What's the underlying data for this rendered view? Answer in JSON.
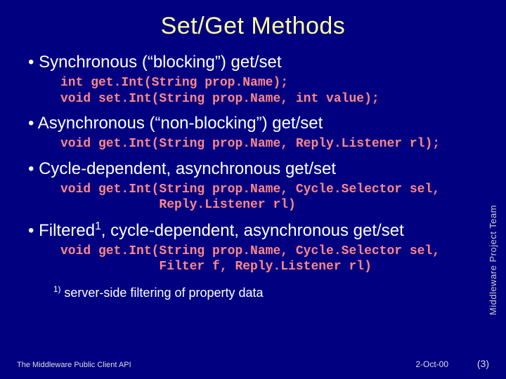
{
  "title": "Set/Get Methods",
  "bullets": {
    "sync": "Synchronous (“blocking”) get/set",
    "async": "Asynchronous (“non-blocking”) get/set",
    "cycle": "Cycle-dependent, asynchronous get/set",
    "filtered_pre": "Filtered",
    "filtered_sup": "1",
    "filtered_post": ", cycle-dependent, asynchronous get/set"
  },
  "code": {
    "sync": "int get.Int(String prop.Name);\nvoid set.Int(String prop.Name, int value);",
    "async": "void get.Int(String prop.Name, Reply.Listener rl);",
    "cycle": "void get.Int(String prop.Name, Cycle.Selector sel,\n             Reply.Listener rl)",
    "filtered": "void get.Int(String prop.Name, Cycle.Selector sel,\n             Filter f, Reply.Listener rl)"
  },
  "footnote": {
    "marker": "1)",
    "text": " server-side filtering of property data"
  },
  "footer": {
    "left": "The Middleware Public Client API",
    "date": "2-Oct-00",
    "page": "(3)"
  },
  "side_label": "Middleware Project Team"
}
